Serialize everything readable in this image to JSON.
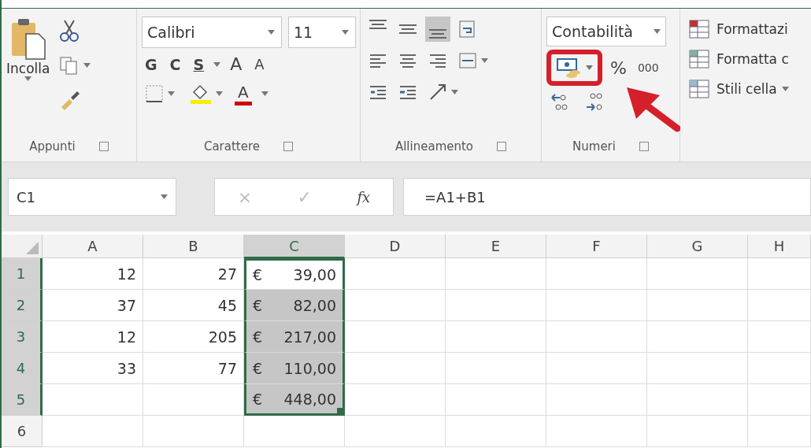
{
  "ribbon": {
    "clipboard": {
      "paste_label": "Incolla",
      "label": "Appunti"
    },
    "font": {
      "font_name": "Calibri",
      "font_size": "11",
      "bold": "G",
      "italic": "C",
      "underline": "S",
      "grow": "A",
      "shrink": "A",
      "font_color": "A",
      "label": "Carattere"
    },
    "alignment": {
      "buttons": [
        {
          "kind": "top",
          "selected": false
        },
        {
          "kind": "middle",
          "selected": false
        },
        {
          "kind": "bottom",
          "selected": true
        }
      ],
      "label": "Allineamento"
    },
    "number": {
      "format": "Contabilità",
      "accounting_annotated": true,
      "percent": "%",
      "thousands": "000",
      "label": "Numeri"
    },
    "styles": [
      {
        "kind": "conditional",
        "label": "Formattazi"
      },
      {
        "kind": "table",
        "label": "Formatta c"
      },
      {
        "kind": "cell",
        "label": "Stili cella"
      }
    ]
  },
  "formula_bar": {
    "name_box": "C1",
    "cancel": "×",
    "enter": "✓",
    "function_label": "fx",
    "formula": "=A1+B1"
  },
  "sheet": {
    "columns": [
      {
        "label": "A",
        "selected": false
      },
      {
        "label": "B",
        "selected": false
      },
      {
        "label": "C",
        "selected": true
      },
      {
        "label": "D",
        "selected": false
      },
      {
        "label": "E",
        "selected": false
      },
      {
        "label": "F",
        "selected": false
      },
      {
        "label": "G",
        "selected": false
      },
      {
        "label": "H",
        "selected": false
      }
    ],
    "rows": [
      {
        "number": "1",
        "selected": true,
        "cells": [
          {
            "value": "12"
          },
          {
            "value": "27"
          },
          {
            "symbol": "€",
            "amount": "39,00",
            "selected": true,
            "active": true
          },
          {},
          {},
          {},
          {},
          {}
        ]
      },
      {
        "number": "2",
        "selected": true,
        "cells": [
          {
            "value": "37"
          },
          {
            "value": "45"
          },
          {
            "symbol": "€",
            "amount": "82,00",
            "selected": true,
            "active": false
          },
          {},
          {},
          {},
          {},
          {}
        ]
      },
      {
        "number": "3",
        "selected": true,
        "cells": [
          {
            "value": "12"
          },
          {
            "value": "205"
          },
          {
            "symbol": "€",
            "amount": "217,00",
            "selected": true,
            "active": false
          },
          {},
          {},
          {},
          {},
          {}
        ]
      },
      {
        "number": "4",
        "selected": true,
        "cells": [
          {
            "value": "33"
          },
          {
            "value": "77"
          },
          {
            "symbol": "€",
            "amount": "110,00",
            "selected": true,
            "active": false
          },
          {},
          {},
          {},
          {},
          {}
        ]
      },
      {
        "number": "5",
        "selected": true,
        "cells": [
          {},
          {},
          {
            "symbol": "€",
            "amount": "448,00",
            "selected": true,
            "active": false
          },
          {},
          {},
          {},
          {},
          {}
        ]
      },
      {
        "number": "6",
        "selected": false,
        "cells": [
          {},
          {},
          {},
          {},
          {},
          {},
          {},
          {}
        ]
      }
    ]
  }
}
